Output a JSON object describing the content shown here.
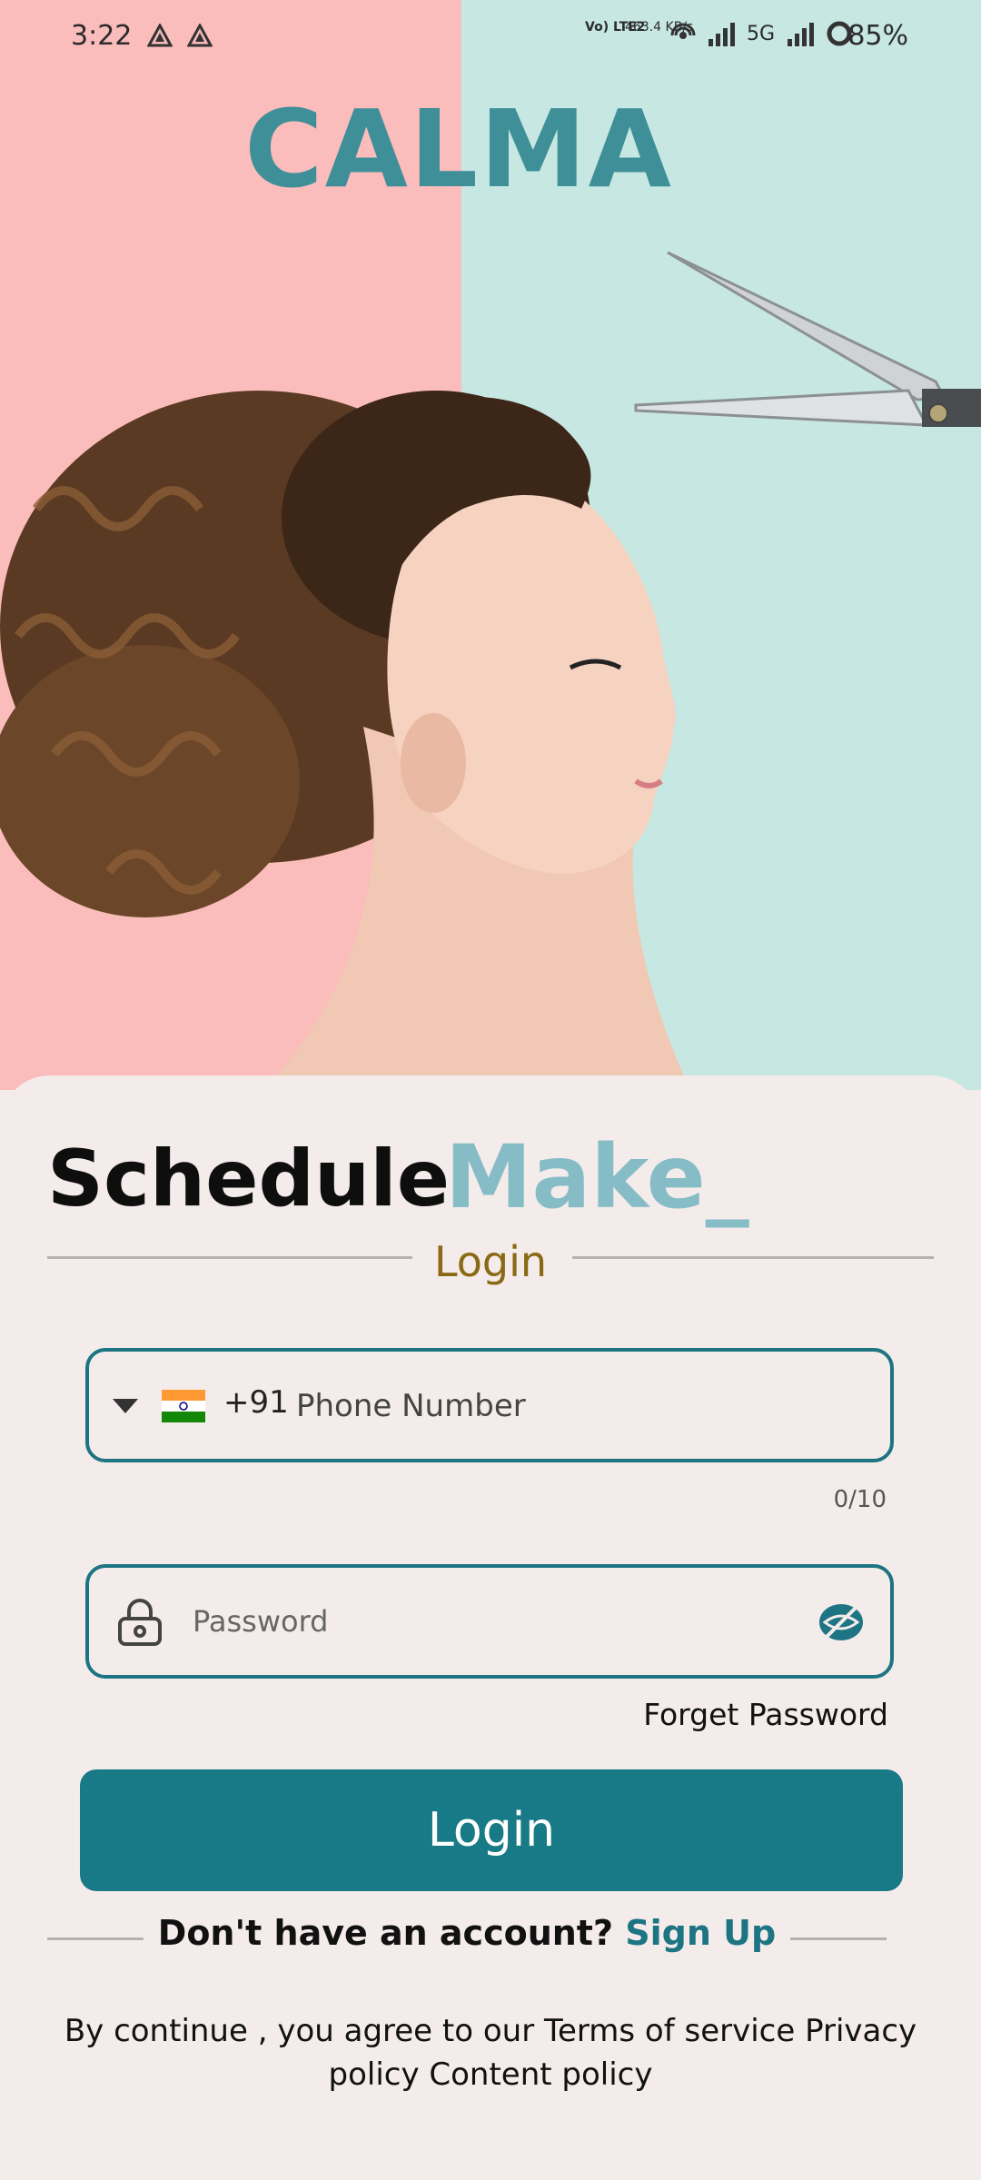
{
  "status_bar": {
    "time": "3:22",
    "network_tag": "Vo) LTE2",
    "speed": "463.4 KB/s",
    "network_gen": "5G",
    "battery": "85%"
  },
  "brand": "CALMA",
  "headline": {
    "primary": "Schedule",
    "secondary": "Make_"
  },
  "divider_label": "Login",
  "phone": {
    "country_code": "+91",
    "placeholder": "Phone Number",
    "counter": "0/10",
    "flag_icon": "india-flag-icon"
  },
  "password": {
    "placeholder": "Password",
    "lock_icon": "lock-icon",
    "eye_icon": "eye-off-icon"
  },
  "forget_label": "Forget Password",
  "login_button": "Login",
  "signup": {
    "prompt": "Don't have an account?",
    "link": "Sign Up"
  },
  "terms_text": "By continue , you agree to  our Terms of service Privacy policy Content policy",
  "colors": {
    "accent": "#187a86",
    "brand": "#3f8f98",
    "pink": "#fbbcbc",
    "mint": "#c7e7e2",
    "card_bg": "#f4ecea",
    "login_label": "#8b6914",
    "headline_secondary": "#86bcc6"
  }
}
